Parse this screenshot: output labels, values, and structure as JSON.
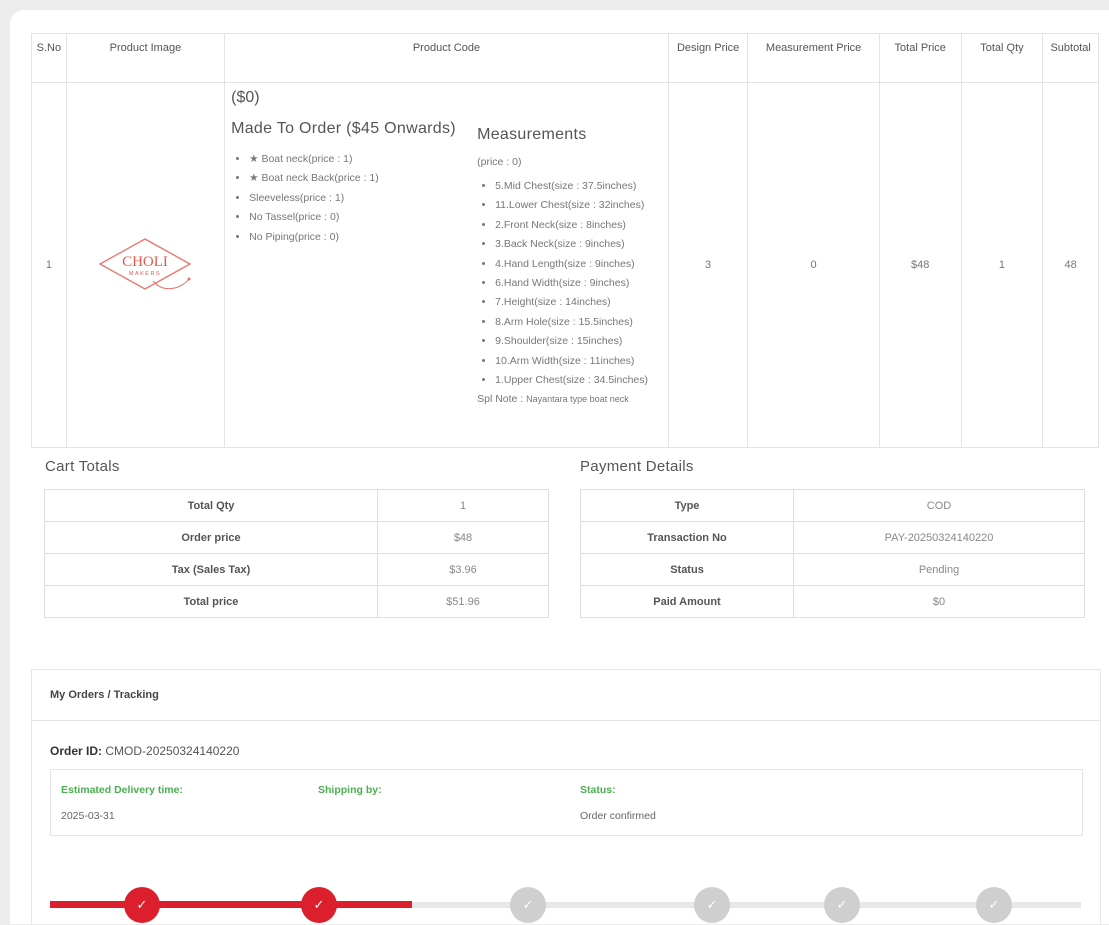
{
  "table": {
    "headers": [
      "S.No",
      "Product Image",
      "Product Code",
      "Design Price",
      "Measurement Price",
      "Total Price",
      "Total Qty",
      "Subtotal"
    ],
    "row": {
      "sno": "1",
      "product_price": "($0)",
      "made_to_order": "Made To Order ($45 Onwards)",
      "options": [
        "★ Boat neck(price : 1)",
        "★ Boat neck Back(price : 1)",
        "Sleeveless(price : 1)",
        "No Tassel(price : 0)",
        "No Piping(price : 0)"
      ],
      "measurements_title": "Measurements",
      "measurements_price": "(price : 0)",
      "measurements": [
        "5.Mid Chest(size : 37.5inches)",
        "11.Lower Chest(size : 32inches)",
        "2.Front Neck(size : 8inches)",
        "3.Back Neck(size : 9inches)",
        "4.Hand Length(size : 9inches)",
        "6.Hand Width(size : 9inches)",
        "7.Height(size : 14inches)",
        "8.Arm Hole(size : 15.5inches)",
        "9.Shoulder(size : 15inches)",
        "10.Arm Width(size : 11inches)",
        "1.Upper Chest(size : 34.5inches)"
      ],
      "spl_note_label": "Spl Note :",
      "spl_note": "Nayantara type boat neck",
      "design_price": "3",
      "measurement_price": "0",
      "total_price": "$48",
      "total_qty": "1",
      "subtotal": "48"
    },
    "logo": {
      "text": "CHOLI",
      "subtext": "MAKERS"
    }
  },
  "cart_totals": {
    "title": "Cart Totals",
    "rows": [
      {
        "label": "Total Qty",
        "value": "1"
      },
      {
        "label": "Order price",
        "value": "$48"
      },
      {
        "label": "Tax (Sales Tax)",
        "value": "$3.96"
      },
      {
        "label": "Total price",
        "value": "$51.96"
      }
    ]
  },
  "payment_details": {
    "title": "Payment Details",
    "rows": [
      {
        "label": "Type",
        "value": "COD"
      },
      {
        "label": "Transaction No",
        "value": "PAY-20250324140220"
      },
      {
        "label": "Status",
        "value": "Pending"
      },
      {
        "label": "Paid Amount",
        "value": "$0"
      }
    ]
  },
  "tracking": {
    "header": "My Orders / Tracking",
    "order_id_label": "Order ID:",
    "order_id": "CMOD-20250324140220",
    "estimated_label": "Estimated Delivery time:",
    "estimated_value": "2025-03-31",
    "shipping_label": "Shipping by:",
    "status_label": "Status:",
    "status_value": "Order confirmed",
    "steps_completed": 2,
    "steps_total": 6,
    "check_glyph": "✓",
    "colors": {
      "accent": "#dc1f2c",
      "label_green": "#4caf50",
      "pending_dot": "#cfcfcf"
    }
  }
}
